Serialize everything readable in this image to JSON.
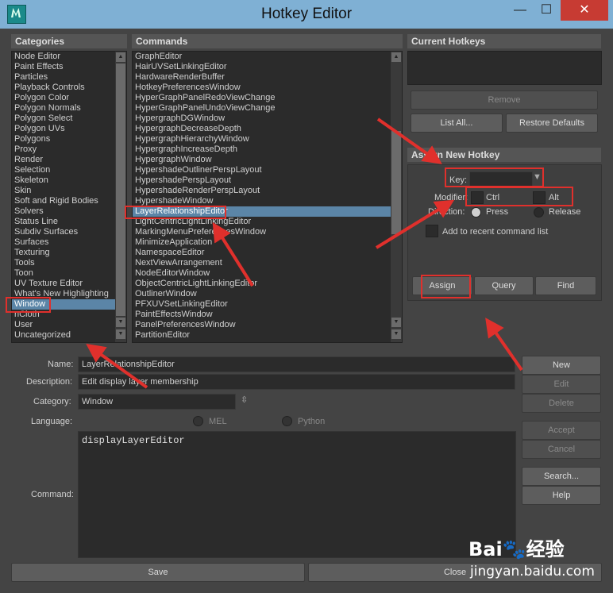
{
  "window": {
    "title": "Hotkey Editor",
    "minimize_glyph": "—",
    "maximize_glyph": "☐",
    "close_glyph": "✕"
  },
  "categories": {
    "header": "Categories",
    "items": [
      "Node Editor",
      "Paint Effects",
      "Particles",
      "Playback Controls",
      "Polygon Color",
      "Polygon Normals",
      "Polygon Select",
      "Polygon UVs",
      "Polygons",
      "Proxy",
      "Render",
      "Selection",
      "Skeleton",
      "Skin",
      "Soft and Rigid Bodies",
      "Solvers",
      "Status Line",
      "Subdiv Surfaces",
      "Surfaces",
      "Texturing",
      "Tools",
      "Toon",
      "UV Texture Editor",
      "What's New Highlighting",
      "Window",
      "nCloth",
      "User",
      "Uncategorized"
    ],
    "selected": "Window"
  },
  "commands": {
    "header": "Commands",
    "items": [
      "GraphEditor",
      "HairUVSetLinkingEditor",
      "HardwareRenderBuffer",
      "HotkeyPreferencesWindow",
      "HyperGraphPanelRedoViewChange",
      "HyperGraphPanelUndoViewChange",
      "HypergraphDGWindow",
      "HypergraphDecreaseDepth",
      "HypergraphHierarchyWindow",
      "HypergraphIncreaseDepth",
      "HypergraphWindow",
      "HypershadeOutlinerPerspLayout",
      "HypershadePerspLayout",
      "HypershadeRenderPerspLayout",
      "HypershadeWindow",
      "LayerRelationshipEditor",
      "LightCentricLightLinkingEditor",
      "MarkingMenuPreferencesWindow",
      "MinimizeApplication",
      "NamespaceEditor",
      "NextViewArrangement",
      "NodeEditorWindow",
      "ObjectCentricLightLinkingEditor",
      "OutlinerWindow",
      "PFXUVSetLinkingEditor",
      "PaintEffectsWindow",
      "PanelPreferencesWindow",
      "PartitionEditor"
    ],
    "selected": "LayerRelationshipEditor"
  },
  "current_hotkeys": {
    "header": "Current Hotkeys",
    "remove": "Remove",
    "list_all": "List All...",
    "restore_defaults": "Restore Defaults"
  },
  "assign": {
    "header": "Assign New Hotkey",
    "key_label": "Key:",
    "key_value": "",
    "modifier_label": "Modifier:",
    "ctrl": "Ctrl",
    "alt": "Alt",
    "direction_label": "Direction:",
    "press": "Press",
    "release": "Release",
    "add_recent": "Add to recent command list",
    "assign_btn": "Assign",
    "query_btn": "Query",
    "find_btn": "Find"
  },
  "details": {
    "name_label": "Name:",
    "name_value": "LayerRelationshipEditor",
    "description_label": "Description:",
    "description_value": "Edit display layer membership",
    "category_label": "Category:",
    "category_value": "Window",
    "language_label": "Language:",
    "mel": "MEL",
    "python": "Python",
    "command_label": "Command:",
    "command_value": "displayLayerEditor"
  },
  "side_buttons": {
    "new": "New",
    "edit": "Edit",
    "delete": "Delete",
    "accept": "Accept",
    "cancel": "Cancel",
    "search": "Search...",
    "help": "Help"
  },
  "bottom": {
    "save": "Save",
    "close": "Close"
  },
  "watermark": {
    "brand_left": "Bai",
    "brand_right": "经验",
    "url": "jingyan.baidu.com"
  },
  "colors": {
    "selection": "#5b85a7",
    "annotation": "#e0302c",
    "titlebar": "#7fb0d4"
  }
}
